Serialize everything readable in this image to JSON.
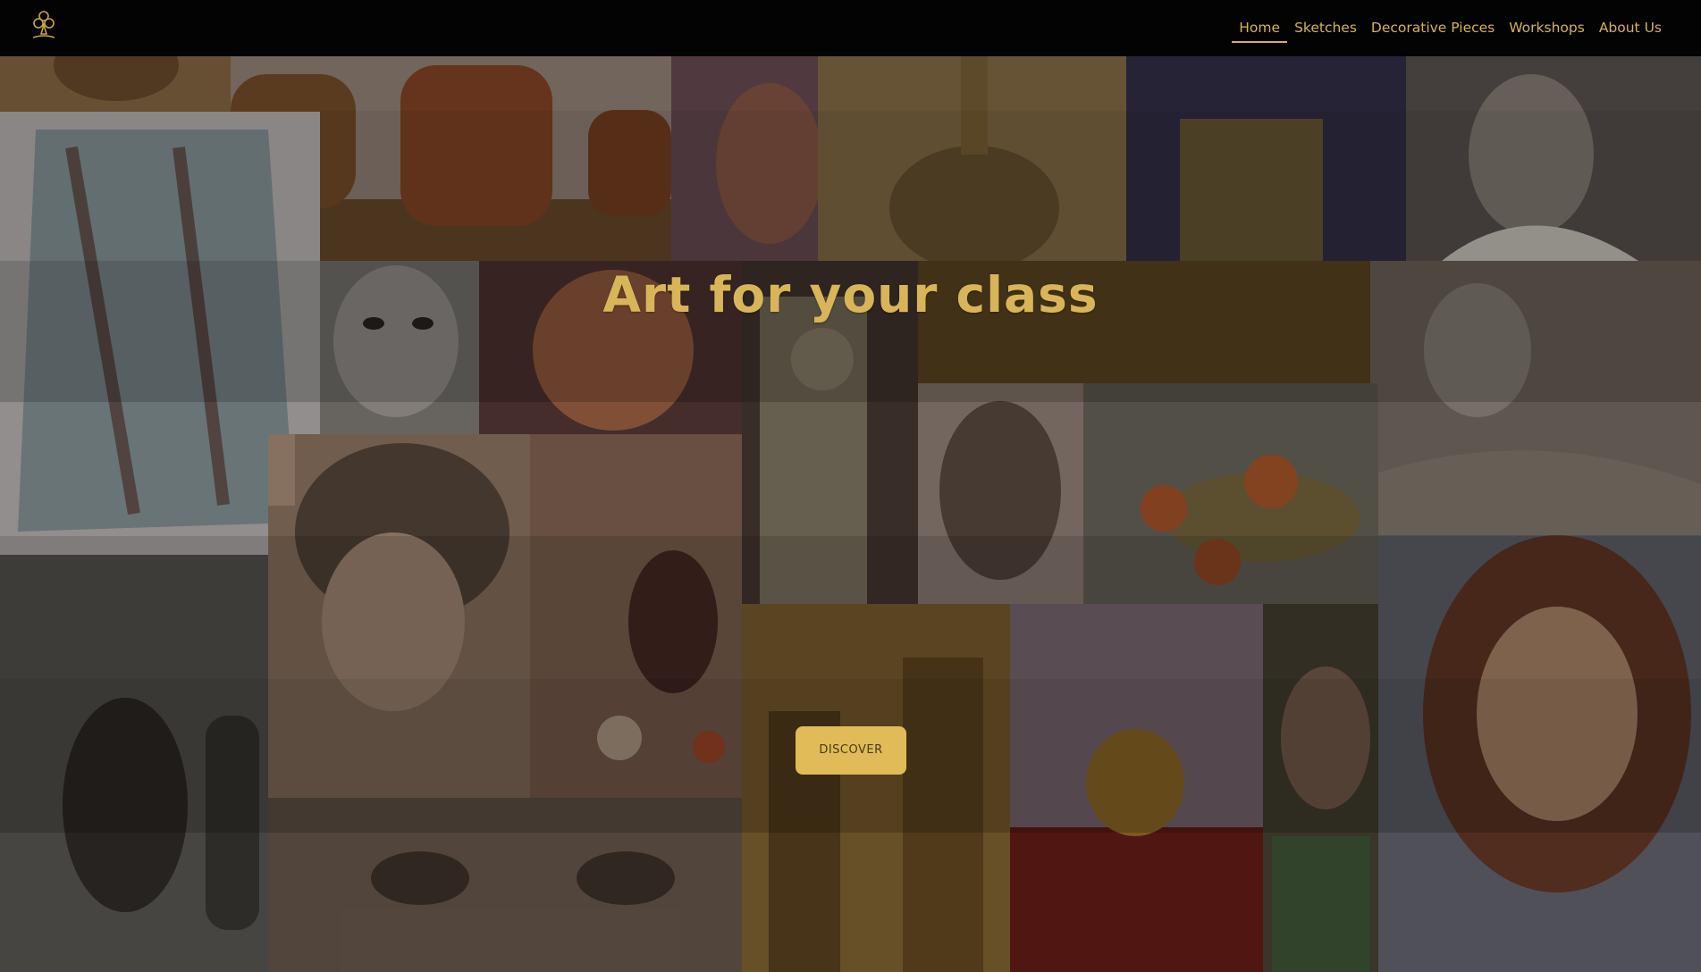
{
  "nav": {
    "items": [
      {
        "label": "Home",
        "active": true
      },
      {
        "label": "Sketches",
        "active": false
      },
      {
        "label": "Decorative Pieces",
        "active": false
      },
      {
        "label": "Workshops",
        "active": false
      },
      {
        "label": "About Us",
        "active": false
      }
    ]
  },
  "hero": {
    "title": "Art for your class",
    "cta_label": "DISCOVER"
  },
  "colors": {
    "accent": "#d9b55a",
    "button": "#e0bb57",
    "header_bg": "#030303"
  }
}
